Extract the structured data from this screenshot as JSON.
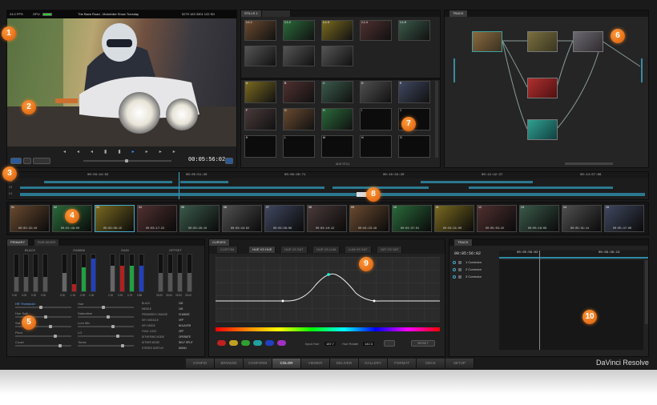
{
  "viewer": {
    "fps": "24.0 FPS",
    "gpu_label": "GPU",
    "clip_title": "The Back Road - Motorbike Show Tuesday",
    "clip_info": "5279 163 3301 122 KD",
    "timecode": "00:05:56:02"
  },
  "gallery": {
    "tab": "STILLS 1",
    "row_labels": [
      "1.1.1",
      "1.1.2",
      "1.1.3",
      "1.1.4",
      "1.1.5"
    ],
    "grid_labels": [
      "A",
      "B",
      "C",
      "D",
      "E",
      "F",
      "G",
      "H",
      "I",
      "J",
      "K",
      "L",
      "M",
      "N",
      "O"
    ],
    "footer": "ADD STILL"
  },
  "node_editor": {
    "tab": "TRACK"
  },
  "timeline": {
    "ruler": [
      "00:03:44:02",
      "00:05:51:20",
      "00:09:26:71",
      "00:10:34:20",
      "00:12:42:37",
      "00:14:57:06"
    ],
    "tracks": [
      "V3",
      "V2",
      "V1"
    ]
  },
  "clips": [
    {
      "n": "01",
      "tc": "00:02:32:10"
    },
    {
      "n": "02",
      "tc": "00:02:48:00"
    },
    {
      "n": "03",
      "tc": "00:03:06:15"
    },
    {
      "n": "04",
      "tc": "00:03:17:22"
    },
    {
      "n": "05",
      "tc": "00:03:28:10"
    },
    {
      "n": "06",
      "tc": "00:03:44:02"
    },
    {
      "n": "07",
      "tc": "00:03:58:06"
    },
    {
      "n": "08",
      "tc": "00:04:10:12"
    },
    {
      "n": "09",
      "tc": "00:04:23:18"
    },
    {
      "n": "10",
      "tc": "00:04:37:01"
    },
    {
      "n": "11",
      "tc": "00:04:51:00"
    },
    {
      "n": "12",
      "tc": "00:05:03:22"
    },
    {
      "n": "13",
      "tc": "00:05:18:09"
    },
    {
      "n": "14",
      "tc": "00:05:31:14"
    },
    {
      "n": "15",
      "tc": "00:05:47:00"
    }
  ],
  "primary": {
    "tabs": [
      "PRIMARY",
      "RGB MIXER"
    ],
    "wheels": [
      {
        "label": "BLACK",
        "values": [
          "0.00",
          "0.00",
          "0.00",
          "0.00"
        ]
      },
      {
        "label": "GAMMA",
        "values": [
          "0.00",
          "-1.00",
          "-0.90",
          "1.06"
        ]
      },
      {
        "label": "GAIN",
        "values": [
          "1.00",
          "0.94",
          "0.75",
          "0.88"
        ]
      },
      {
        "label": "OFFSET",
        "values": [
          "25.00",
          "25.00",
          "25.00",
          "25.00"
        ]
      }
    ],
    "params_left": [
      "HR Threshold",
      "Hue Soft",
      "Sat",
      "Pivot",
      "Crush"
    ],
    "params_mid": [
      "Hue",
      "Saturation",
      "Lum Mix",
      "LG",
      "Tones"
    ],
    "params_right": [
      {
        "k": "BLACK",
        "v": "100"
      },
      {
        "k": "MIDDLE",
        "v": "100"
      },
      {
        "k": "PRIMARIES CHANGE",
        "v": "CHANGE"
      },
      {
        "k": "KEY MODULE",
        "v": "OFF"
      },
      {
        "k": "KEY MODE",
        "v": "NOLAYER"
      },
      {
        "k": "FUNC LOCK",
        "v": "OFF"
      },
      {
        "k": "DITHERING MODE",
        "v": "OPERATE"
      },
      {
        "k": "DITHER MODE",
        "v": "SELF SPLIT"
      },
      {
        "k": "STEREO DISPLAY",
        "v": "MONO"
      }
    ]
  },
  "curves": {
    "tabs": [
      "CURVES",
      "CUSTOM",
      "HUE VS HUE",
      "HUE VS SAT",
      "HUE VS LUM",
      "LUM VS SAT",
      "SAT VS SAT"
    ],
    "input_label": "Input Hue",
    "input_value": "187.7",
    "rotate_label": "Hue Rotate",
    "rotate_value": "142.3",
    "reset_label": "RESET",
    "swatches": [
      "#c02020",
      "#c0a020",
      "#30a030",
      "#20a0a0",
      "#2040c0",
      "#a030c0"
    ]
  },
  "keyframes": {
    "tab": "TRACK",
    "timecodes": [
      "00:05:56:02",
      "00:05:56:02",
      "00:09:26:13"
    ],
    "rows": [
      "1 Corrector",
      "2 Corrector",
      "3 Corrector"
    ]
  },
  "nav": {
    "items": [
      "CONFIG",
      "BROWSE",
      "CONFORM",
      "COLOR",
      "VIEWER",
      "DELIVER",
      "GALLERY",
      "FORMAT",
      "DECK",
      "SETUP"
    ],
    "active": "COLOR"
  },
  "brand": "DaVinci Resolve",
  "callouts": [
    "1",
    "2",
    "3",
    "4",
    "5",
    "6",
    "7",
    "8",
    "9",
    "10"
  ]
}
